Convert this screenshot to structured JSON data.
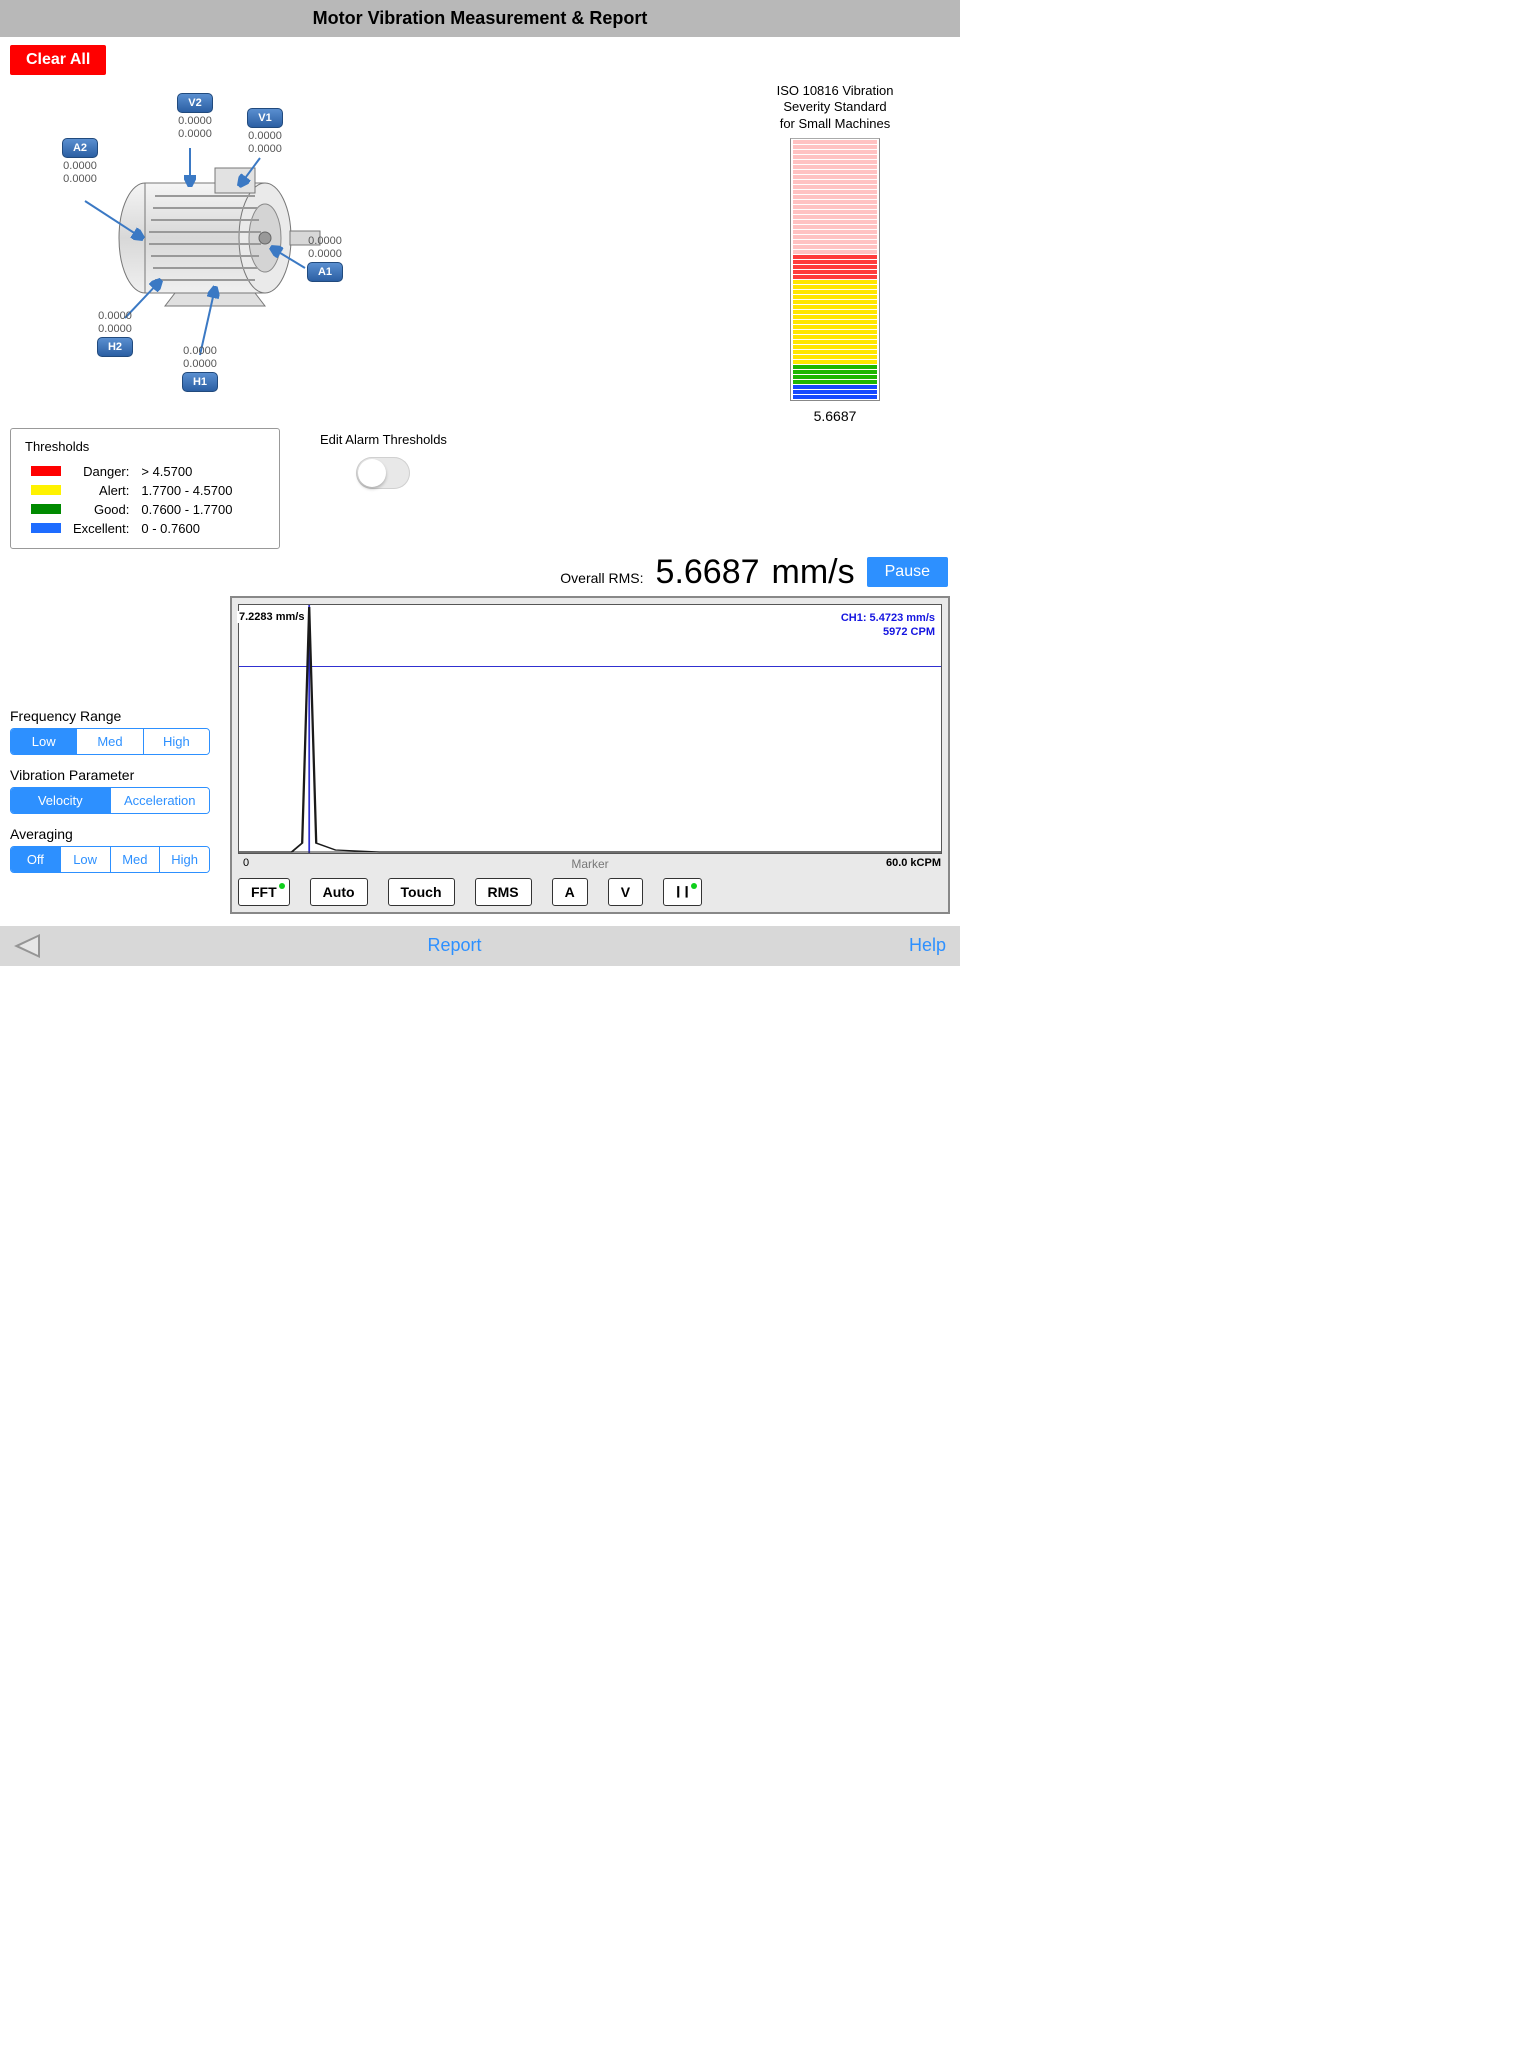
{
  "title": "Motor Vibration Measurement & Report",
  "clear_btn": "Clear All",
  "points": {
    "V2": {
      "label": "V2",
      "v1": "0.0000",
      "v2": "0.0000"
    },
    "V1": {
      "label": "V1",
      "v1": "0.0000",
      "v2": "0.0000"
    },
    "A2": {
      "label": "A2",
      "v1": "0.0000",
      "v2": "0.0000"
    },
    "A1": {
      "label": "A1",
      "v1": "0.0000",
      "v2": "0.0000"
    },
    "H2": {
      "label": "H2",
      "v1": "0.0000",
      "v2": "0.0000"
    },
    "H1": {
      "label": "H1",
      "v1": "0.0000",
      "v2": "0.0000"
    }
  },
  "iso": {
    "title1": "ISO 10816 Vibration",
    "title2": "Severity Standard",
    "title3": "for Small Machines",
    "value": "5.6687"
  },
  "thresholds": {
    "title": "Thresholds",
    "danger_label": "Danger:",
    "danger_range": "> 4.5700",
    "alert_label": "Alert:",
    "alert_range": "1.7700 - 4.5700",
    "good_label": "Good:",
    "good_range": "0.7600 - 1.7700",
    "excellent_label": "Excellent:",
    "excellent_range": "0 - 0.7600"
  },
  "edit_alarm_label": "Edit Alarm Thresholds",
  "rms": {
    "label": "Overall RMS:",
    "value": "5.6687",
    "unit": "mm/s"
  },
  "pause_btn": "Pause",
  "chart": {
    "y_peak": "7.2283 mm/s",
    "ch1_line1": "CH1: 5.4723 mm/s",
    "ch1_line2": "5972 CPM",
    "x0": "0",
    "xmark": "Marker",
    "xmax": "60.0 kCPM",
    "btn_fft": "FFT",
    "btn_auto": "Auto",
    "btn_touch": "Touch",
    "btn_rms": "RMS",
    "btn_a": "A",
    "btn_v": "V",
    "btn_pause": "❙❙"
  },
  "controls": {
    "freq_label": "Frequency Range",
    "freq_opts": [
      "Low",
      "Med",
      "High"
    ],
    "param_label": "Vibration Parameter",
    "param_opts": [
      "Velocity",
      "Acceleration"
    ],
    "avg_label": "Averaging",
    "avg_opts": [
      "Off",
      "Low",
      "Med",
      "High"
    ]
  },
  "bottom": {
    "report": "Report",
    "help": "Help"
  },
  "chart_data": {
    "type": "line",
    "title": "FFT Spectrum",
    "xlabel": "Marker",
    "ylabel": "mm/s",
    "x_unit": "kCPM",
    "xlim": [
      0,
      60.0
    ],
    "ylim": [
      0,
      7.2283
    ],
    "marker": {
      "x_cpm": 5972,
      "y_mm_s": 5.4723,
      "channel": "CH1"
    },
    "series": [
      {
        "name": "CH1",
        "x": [
          0,
          2,
          4,
          5.972,
          8,
          12,
          20,
          40,
          60
        ],
        "values": [
          0,
          0.1,
          0.3,
          7.2283,
          0.2,
          0.1,
          0.05,
          0.02,
          0.01
        ]
      }
    ]
  }
}
